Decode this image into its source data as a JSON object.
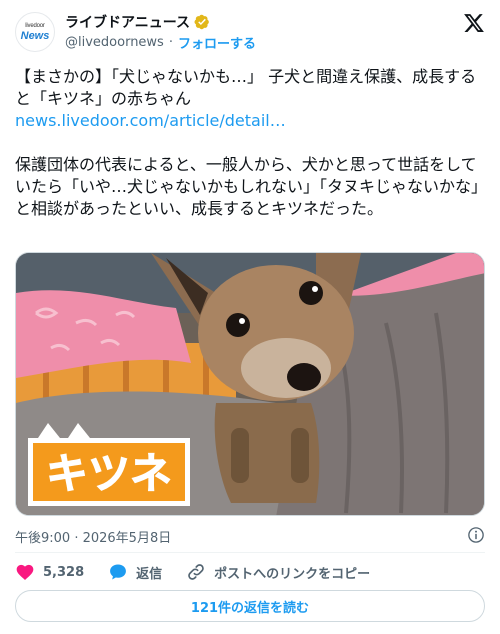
{
  "account": {
    "avatar_small_text": "livedoor",
    "avatar_big_text": "News",
    "display_name": "ライブドアニュース",
    "handle": "@livedoornews",
    "separator": "·",
    "follow_label": "フォローする"
  },
  "tweet": {
    "headline": "【まさかの】「犬じゃないかも…」 子犬と間違え保護、成長すると「キツネ」の赤ちゃん",
    "link_text": "news.livedoor.com/article/detail…",
    "body": "保護団体の代表によると、一般人から、犬かと思って世話をしていたら「いや…犬じゃないかもしれない」「タヌキじゃないかな」と相談があったといい、成長するとキツネだった。"
  },
  "media": {
    "overlay_text": "キツネ",
    "colors": {
      "overlay_bg": "#f49a1c",
      "overlay_text": "#ffffff"
    }
  },
  "meta": {
    "timestamp": "午後9:00 · 2026年5月8日",
    "icon": "info-icon"
  },
  "actions": {
    "like_count": "5,328",
    "reply_label": "返信",
    "copy_link_label": "ポストへのリンクをコピー"
  },
  "replies_button_label": "121件の返信を読む",
  "colors": {
    "accent": "#1d9bf0",
    "like": "#f91880",
    "verified": "#e2b719",
    "text": "#0f1419",
    "muted": "#536471"
  }
}
